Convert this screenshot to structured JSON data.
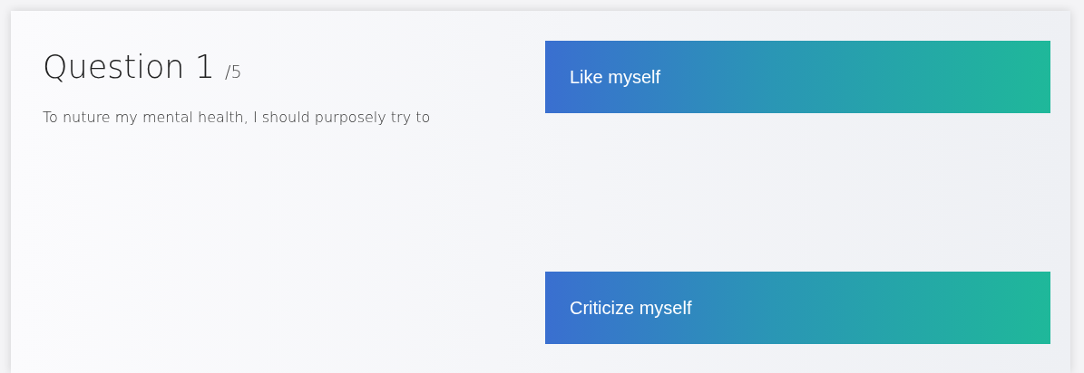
{
  "question": {
    "heading": "Question 1",
    "total": "/5",
    "prompt": "To nuture my mental health, I should purposely try to"
  },
  "answers": [
    {
      "label": "Like myself"
    },
    {
      "label": "Criticize myself"
    }
  ]
}
